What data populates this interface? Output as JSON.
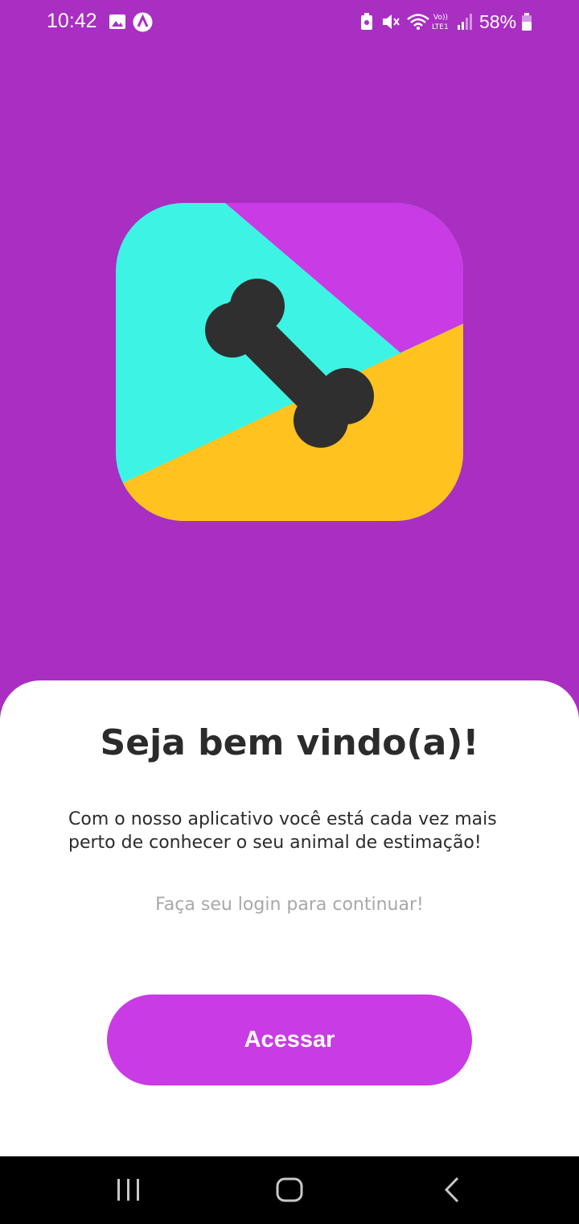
{
  "status_bar": {
    "time": "10:42",
    "battery": "58%",
    "icons": [
      "gallery-icon",
      "app-notification-icon",
      "battery-saver-icon",
      "mute-icon",
      "wifi-icon",
      "volte-icon",
      "signal-icon",
      "battery-icon"
    ]
  },
  "colors": {
    "background": "#a92ec2",
    "logo_cyan": "#3df4e4",
    "logo_purple": "#c93be4",
    "logo_yellow": "#ffc21e",
    "logo_bone": "#2f2f2f",
    "button": "#c93be4"
  },
  "welcome": {
    "title": "Seja bem vindo(a)!",
    "description": "Com o nosso aplicativo você está cada vez mais perto de conhecer o seu animal de estimação!",
    "login_hint": "Faça seu login para continuar!",
    "button_label": "Acessar"
  },
  "nav_bar": {
    "icons": [
      "recent-apps-icon",
      "home-icon",
      "back-icon"
    ]
  }
}
